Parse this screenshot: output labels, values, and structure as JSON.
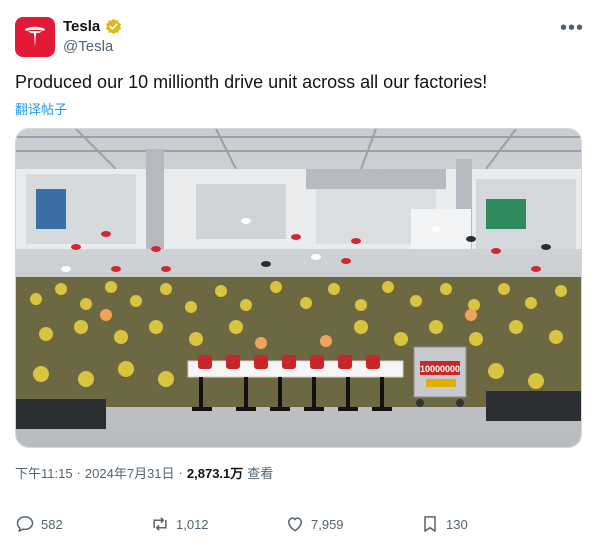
{
  "author": {
    "name": "Tesla",
    "handle": "@Tesla"
  },
  "post": {
    "text": "Produced our 10 millionth drive unit across all our factories!",
    "translate_label": "翻译帖子",
    "image_sign": "10000000"
  },
  "meta": {
    "time": "下午11:15",
    "separator": "·",
    "date": "2024年7月31日",
    "views_count": "2,873.1万",
    "views_label": "查看"
  },
  "actions": {
    "replies": "582",
    "reposts": "1,012",
    "likes": "7,959",
    "bookmarks": "130"
  },
  "icons": {
    "more": "more-icon",
    "verified": "verified-badge-icon",
    "reply": "reply-icon",
    "repost": "repost-icon",
    "like": "heart-icon",
    "bookmark": "bookmark-icon"
  },
  "colors": {
    "brand_red": "#e31937",
    "verified_gold": "#e2b719",
    "link_blue": "#1d9bf0",
    "muted": "#536471"
  }
}
